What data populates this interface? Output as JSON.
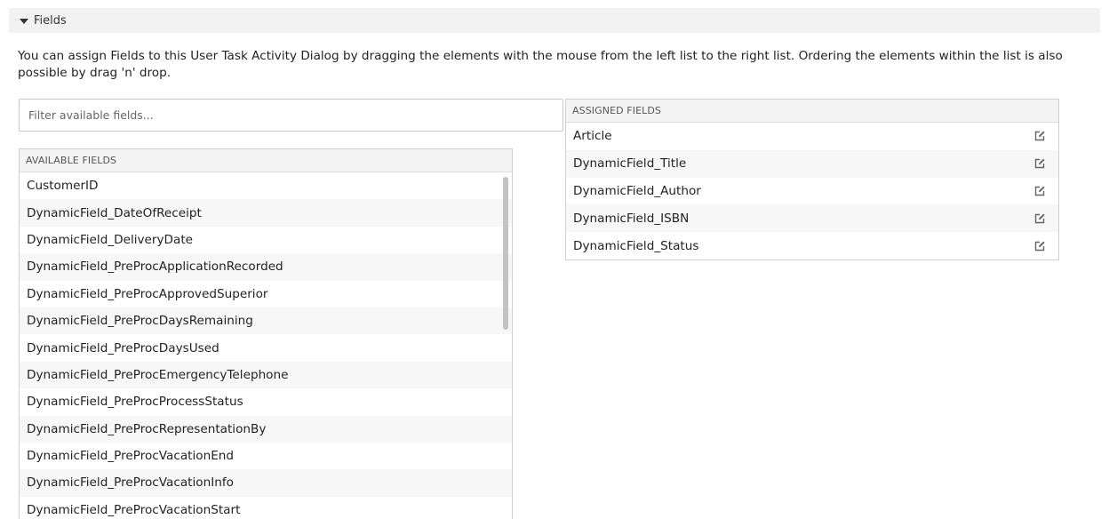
{
  "section": {
    "title": "Fields"
  },
  "description": "You can assign Fields to this User Task Activity Dialog by dragging the elements with the mouse from the left list to the right list. Ordering the elements within the list is also possible by drag 'n' drop.",
  "filter": {
    "placeholder": "Filter available fields...",
    "value": ""
  },
  "available": {
    "header": "AVAILABLE FIELDS",
    "items": [
      "CustomerID",
      "DynamicField_DateOfReceipt",
      "DynamicField_DeliveryDate",
      "DynamicField_PreProcApplicationRecorded",
      "DynamicField_PreProcApprovedSuperior",
      "DynamicField_PreProcDaysRemaining",
      "DynamicField_PreProcDaysUsed",
      "DynamicField_PreProcEmergencyTelephone",
      "DynamicField_PreProcProcessStatus",
      "DynamicField_PreProcRepresentationBy",
      "DynamicField_PreProcVacationEnd",
      "DynamicField_PreProcVacationInfo",
      "DynamicField_PreProcVacationStart"
    ]
  },
  "assigned": {
    "header": "ASSIGNED FIELDS",
    "items": [
      "Article",
      "DynamicField_Title",
      "DynamicField_Author",
      "DynamicField_ISBN",
      "DynamicField_Status"
    ]
  },
  "icons": {
    "toggle": "caret-down-icon",
    "edit": "edit-icon"
  },
  "colors": {
    "header_bg": "#f2f2f2",
    "border": "#cfcfcf",
    "row_alt": "#f7f7f7",
    "icon": "#666666"
  }
}
